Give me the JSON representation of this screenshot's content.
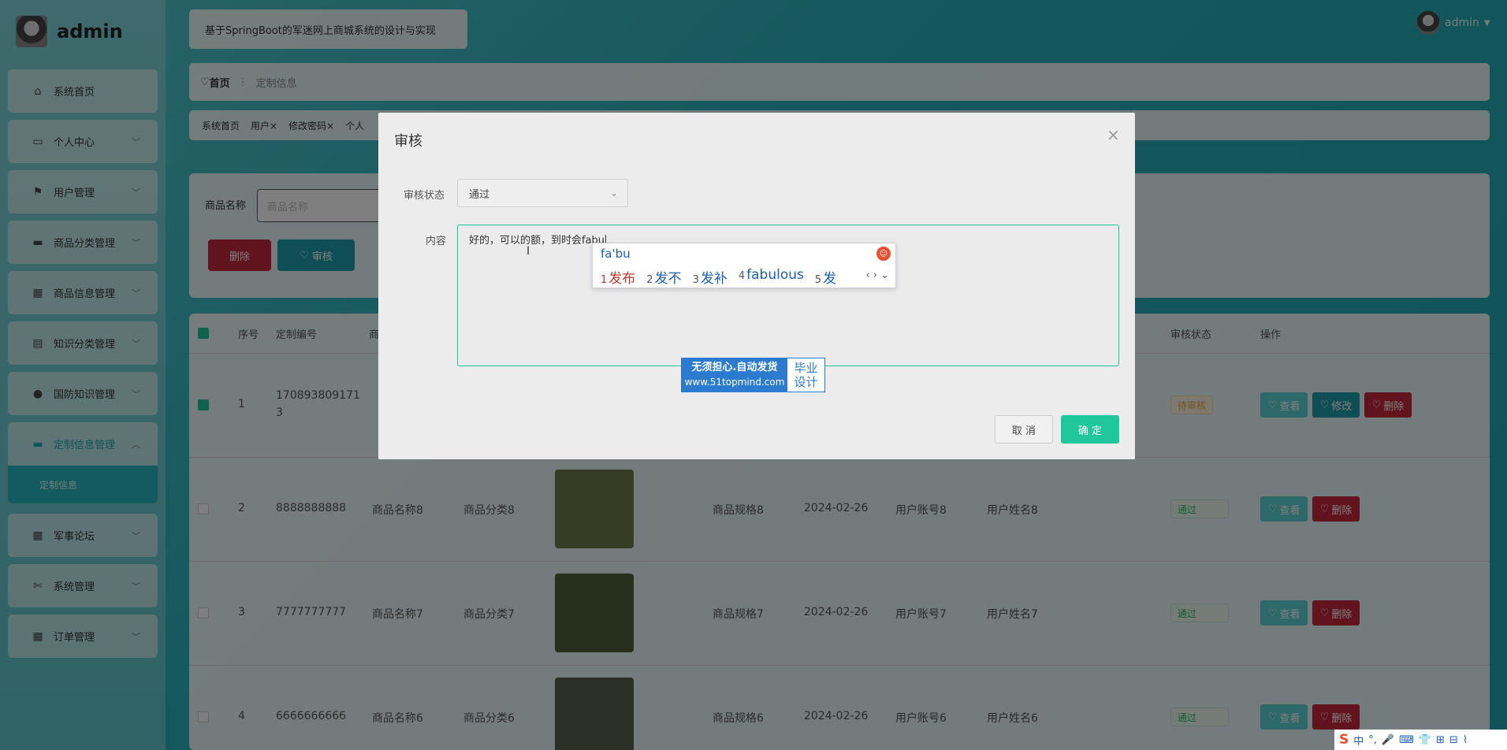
{
  "app": {
    "name": "admin",
    "title": "基于SpringBoot的军迷网上商城系统的设计与实现",
    "user": "admin"
  },
  "sidebar": {
    "items": [
      {
        "label": "系统首页",
        "icon": "home-icon",
        "glyph": "⌂"
      },
      {
        "label": "个人中心",
        "icon": "user-card-icon",
        "glyph": "▭"
      },
      {
        "label": "用户管理",
        "icon": "flag-icon",
        "glyph": "⚑"
      },
      {
        "label": "商品分类管理",
        "icon": "briefcase-icon",
        "glyph": "▬"
      },
      {
        "label": "商品信息管理",
        "icon": "grid-icon",
        "glyph": "▦"
      },
      {
        "label": "知识分类管理",
        "icon": "clipboard-icon",
        "glyph": "▤"
      },
      {
        "label": "国防知识管理",
        "icon": "balloon-icon",
        "glyph": "●"
      },
      {
        "label": "定制信息管理",
        "icon": "monitor-icon",
        "glyph": "▬"
      },
      {
        "label": "军事论坛",
        "icon": "grid-icon",
        "glyph": "▦"
      },
      {
        "label": "系统管理",
        "icon": "ticket-icon",
        "glyph": "✄"
      },
      {
        "label": "订单管理",
        "icon": "grid-icon",
        "glyph": "▦"
      }
    ],
    "submenu": "定制信息"
  },
  "breadcrumb": {
    "home": "首页",
    "current": "定制信息"
  },
  "tabs": [
    "系统首页",
    "用户",
    "修改密码",
    "个人"
  ],
  "search": {
    "label": "商品名称",
    "placeholder": "商品名称",
    "delete": "删除",
    "audit": "审核"
  },
  "table": {
    "headers": [
      "序号",
      "定制编号",
      "商",
      "审核状态",
      "操作"
    ],
    "rows": [
      {
        "no": "1",
        "code": "170893809171",
        "code2": "3",
        "name": "商",
        "cat": "",
        "spec": "",
        "date": "",
        "account": "",
        "uname": "",
        "status": "待审核",
        "checked": true,
        "edit": true
      },
      {
        "no": "2",
        "code": "8888888888",
        "name": "商品名称8",
        "cat": "商品分类8",
        "spec": "商品规格8",
        "date": "2024-02-26",
        "account": "用户账号8",
        "uname": "用户姓名8",
        "status": "通过",
        "checked": false,
        "edit": false
      },
      {
        "no": "3",
        "code": "7777777777",
        "name": "商品名称7",
        "cat": "商品分类7",
        "spec": "商品规格7",
        "date": "2024-02-26",
        "account": "用户账号7",
        "uname": "用户姓名7",
        "status": "通过",
        "checked": false,
        "edit": false
      },
      {
        "no": "4",
        "code": "6666666666",
        "name": "商品名称6",
        "cat": "商品分类6",
        "spec": "商品规格6",
        "date": "2024-02-26",
        "account": "用户账号6",
        "uname": "用户姓名6",
        "status": "通过",
        "checked": false,
        "edit": false
      }
    ],
    "actions": {
      "view": "查看",
      "edit": "修改",
      "delete": "删除"
    }
  },
  "dialog": {
    "title": "审核",
    "status_label": "审核状态",
    "status_value": "通过",
    "content_label": "内容",
    "content_value": "好的，可以的额，到时会fabu",
    "cancel": "取 消",
    "confirm": "确 定"
  },
  "ime": {
    "pinyin": "fa'bu",
    "candidates": [
      {
        "n": "1",
        "t": "发布"
      },
      {
        "n": "2",
        "t": "发不"
      },
      {
        "n": "3",
        "t": "发补"
      },
      {
        "n": "4",
        "t": "fabulous"
      },
      {
        "n": "5",
        "t": "发"
      }
    ]
  },
  "ad": {
    "line1": "无须担心.自动发货",
    "url": "www.51topmind.com",
    "r1": "毕业",
    "r2": "设计"
  },
  "tray": {
    "items": [
      "S",
      "中",
      "°,",
      "🎤",
      "⌨",
      "👕",
      "⊞",
      "⊟",
      "⌇"
    ]
  },
  "colors": {
    "accent": "#1fc79a",
    "teal": "#29b6bf",
    "danger": "#c2293a"
  }
}
